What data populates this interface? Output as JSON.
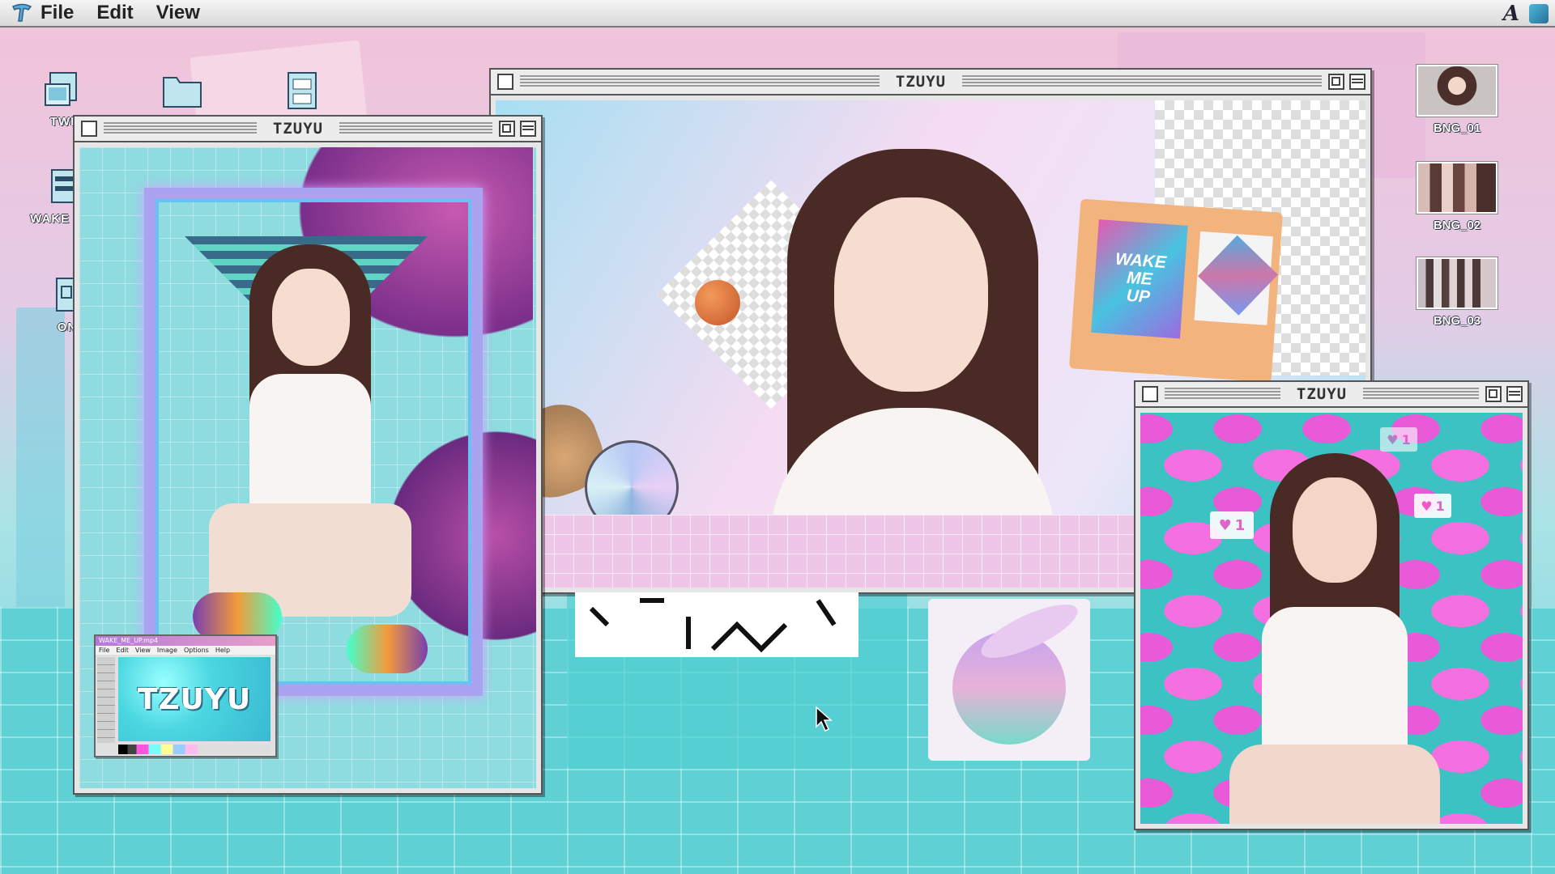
{
  "menubar": {
    "items": [
      "File",
      "Edit",
      "View"
    ],
    "right_icons": [
      "font-icon",
      "app-icon"
    ]
  },
  "desktop_icons": [
    {
      "label": "TWI",
      "icon": "computer-icon"
    },
    {
      "label": "",
      "icon": "folder-icon"
    },
    {
      "label": "",
      "icon": "file-cabinet-icon"
    },
    {
      "label": "WAKE M",
      "icon": "program-icon"
    },
    {
      "label": "ON",
      "icon": "document-icon"
    }
  ],
  "thumbnails": [
    {
      "label": "BNG_01",
      "color": "#7a5a57"
    },
    {
      "label": "BNG_02",
      "color": "#8b5f5c"
    },
    {
      "label": "BNG_03",
      "color": "#9a8a92"
    }
  ],
  "windows": {
    "left": {
      "title": "TZUYU"
    },
    "center": {
      "title": "TZUYU"
    },
    "right": {
      "title": "TZUYU"
    }
  },
  "poster": {
    "lines": [
      "WAKE",
      "ME",
      "UP"
    ]
  },
  "mini_paint": {
    "title": "WAKE_ME_UP.mp4",
    "menu": [
      "File",
      "Edit",
      "View",
      "Image",
      "Options",
      "Help"
    ],
    "canvas_text": "TZUYU"
  },
  "likes": [
    {
      "count": "1"
    },
    {
      "count": "1"
    },
    {
      "count": "1"
    }
  ],
  "colors": {
    "accent_pink": "#f07ad8",
    "accent_teal": "#3fc9cf",
    "window_chrome": "#e6e6e6"
  }
}
